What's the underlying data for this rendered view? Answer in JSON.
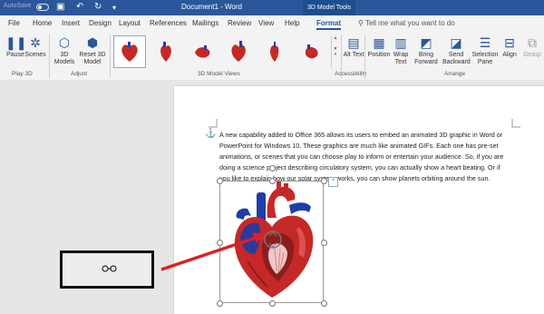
{
  "titlebar": {
    "autosave_label": "AutoSave",
    "doc_title": "Document1 - Word",
    "tools_tab": "3D Model Tools"
  },
  "tabs": [
    "File",
    "Home",
    "Insert",
    "Design",
    "Layout",
    "References",
    "Mailings",
    "Review",
    "View",
    "Help",
    "Format"
  ],
  "active_tab": "Format",
  "tell_me": "Tell me what you want to do",
  "ribbon": {
    "play3d": {
      "pause": "Pause",
      "scenes": "Scenes",
      "group": "Play 3D"
    },
    "adjust": {
      "models": "3D Models",
      "reset": "Reset 3D Model",
      "group": "Adjust"
    },
    "views_group": "3D Model Views",
    "accessibility": {
      "alt_text": "Alt Text",
      "group": "Accessibility"
    },
    "arrange": {
      "position": "Position",
      "wrap": "Wrap Text",
      "bring": "Bring Forward",
      "send": "Send Backward",
      "selection": "Selection Pane",
      "align": "Align",
      "group_btn": "Group",
      "group": "Arrange"
    }
  },
  "document": {
    "paragraph": "A new capability added to Office 365 allows its users to embed an animated 3D graphic in Word or PowerPoint for Windows 10. These graphics are much like animated GIFs. Each one has pre-set animations, or scenes that you can choose play to inform or entertain your audience. So, if you are doing a science project describing circulatory system, you can actually show a heart beating. Or if you like to explain how our solar system works, you can show planets orbiting around the sun."
  },
  "colors": {
    "brand": "#2b579a",
    "heart_red": "#c62828",
    "vessel_blue": "#1e3ea8",
    "arrow_red": "#e02020"
  }
}
